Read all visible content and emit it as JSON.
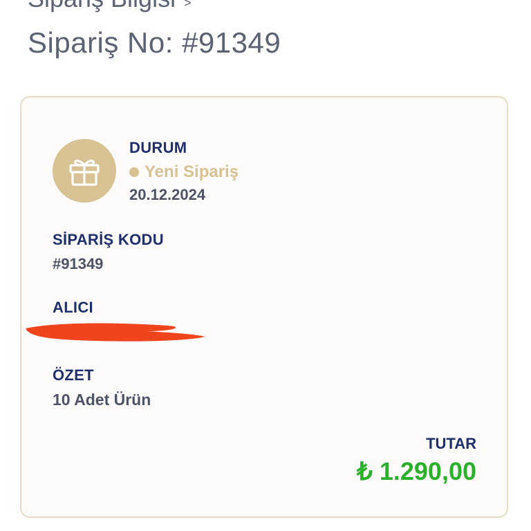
{
  "header": {
    "breadcrumb_label": "Sipariş Bilgisi",
    "breadcrumb_chevron": ">",
    "order_title": "Sipariş No: #91349"
  },
  "card": {
    "status": {
      "label": "DURUM",
      "value": "Yeni Sipariş",
      "date": "20.12.2024",
      "icon": "gift-icon"
    },
    "order_code": {
      "label": "SİPARİŞ KODU",
      "value": "#91349"
    },
    "recipient": {
      "label": "ALICI"
    },
    "summary": {
      "label": "ÖZET",
      "value": "10 Adet Ürün"
    },
    "total": {
      "label": "TUTAR",
      "value": "₺ 1.290,00"
    }
  },
  "colors": {
    "accent_gold": "#d8c293",
    "heading_navy": "#1e2f6b",
    "price_green": "#2bb02b",
    "redaction_red": "#f0441c"
  }
}
